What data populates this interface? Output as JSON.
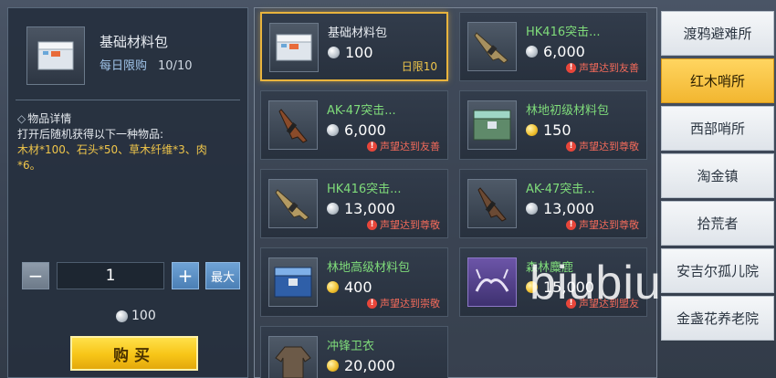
{
  "detail": {
    "item_name": "基础材料包",
    "limit_label": "每日限购",
    "limit_count": "10/10",
    "info_title": "物品详情",
    "desc_line1": "打开后随机获得以下一种物品:",
    "desc_line2": "木材*100、石头*50、草木纤维*3、肉",
    "desc_line3": "*6。",
    "quantity": "1",
    "minus_label": "−",
    "plus_label": "+",
    "max_label": "最大",
    "total_price": "100",
    "buy_label": "购买"
  },
  "items": [
    {
      "title": "基础材料包",
      "price": "100",
      "currency": "silver",
      "note": "日限10",
      "note_type": "daily",
      "title_color": "white",
      "selected": true
    },
    {
      "title": "HK416突击...",
      "price": "6,000",
      "currency": "silver",
      "note": "声望达到友善",
      "note_type": "req"
    },
    {
      "title": "AK-47突击...",
      "price": "6,000",
      "currency": "silver",
      "note": "声望达到友善",
      "note_type": "req"
    },
    {
      "title": "林地初级材料包",
      "price": "150",
      "currency": "gold",
      "note": "声望达到尊敬",
      "note_type": "req"
    },
    {
      "title": "HK416突击...",
      "price": "13,000",
      "currency": "silver",
      "note": "声望达到尊敬",
      "note_type": "req"
    },
    {
      "title": "AK-47突击...",
      "price": "13,000",
      "currency": "silver",
      "note": "声望达到尊敬",
      "note_type": "req"
    },
    {
      "title": "林地高级材料包",
      "price": "400",
      "currency": "gold",
      "note": "声望达到崇敬",
      "note_type": "req"
    },
    {
      "title": "森林麋鹿",
      "price": "15,000",
      "currency": "gold",
      "note": "声望达到盟友",
      "note_type": "req"
    },
    {
      "title": "冲锋卫衣",
      "price": "20,000",
      "currency": "gold",
      "note": "",
      "note_type": "none"
    }
  ],
  "tabs": [
    "渡鸦避难所",
    "红木哨所",
    "西部哨所",
    "淘金镇",
    "拾荒者",
    "安吉尔孤儿院",
    "金盏花养老院"
  ],
  "active_tab": 1,
  "watermark": "biubiu",
  "colors": {
    "accent": "#f2b630",
    "green_title": "#7fdc7a",
    "warning": "#f26a5a"
  }
}
